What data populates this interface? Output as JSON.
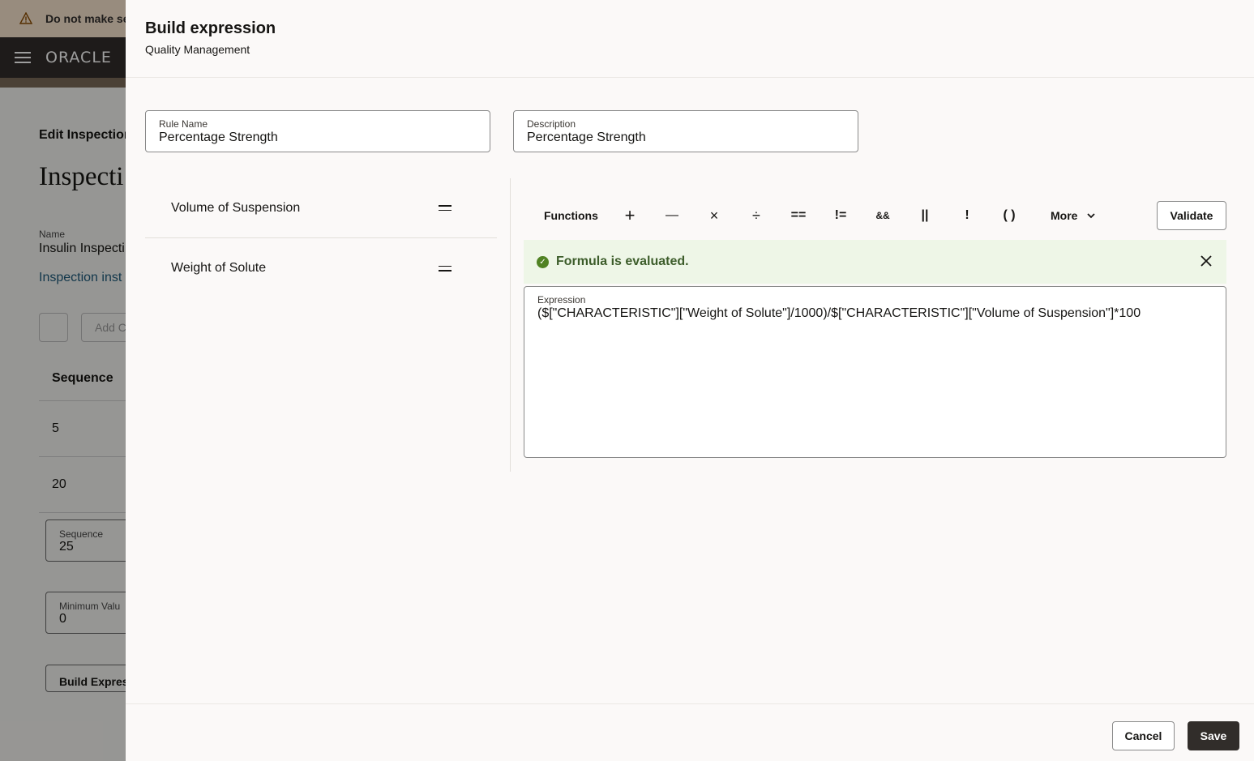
{
  "background": {
    "banner_text": "Do not make se",
    "logo_text": "ORACLE",
    "breadcrumb": "Edit Inspection",
    "page_title": "Inspecti",
    "name_label": "Name",
    "name_value": "Insulin Inspecti",
    "link_text": "Inspection inst",
    "add_button": "Add C",
    "sequence_header": "Sequence",
    "rows": [
      "5",
      "20"
    ],
    "sequence_field": {
      "label": "Sequence",
      "value": "25"
    },
    "min_value_field": {
      "label": "Minimum Valu",
      "value": "0"
    },
    "build_button": "Build Express"
  },
  "drawer": {
    "title": "Build expression",
    "subtitle": "Quality Management",
    "rule_name": {
      "label": "Rule Name",
      "value": "Percentage Strength"
    },
    "description": {
      "label": "Description",
      "value": "Percentage Strength"
    },
    "characteristics": [
      {
        "name": "Volume of Suspension",
        "icon": "drag-handle-icon"
      },
      {
        "name": "Weight of Solute",
        "icon": "drag-handle-icon"
      }
    ],
    "toolbar": {
      "functions_label": "Functions",
      "operators": [
        "+",
        "—",
        "×",
        "÷",
        "==",
        "!=",
        "&&",
        "||",
        "!",
        "( )"
      ],
      "more_label": "More",
      "validate_label": "Validate"
    },
    "message": {
      "text": "Formula is evaluated.",
      "type": "success",
      "color": "#508223"
    },
    "expression": {
      "label": "Expression",
      "value": "($[\"CHARACTERISTIC\"][\"Weight of Solute\"]/1000)/$[\"CHARACTERISTIC\"][\"Volume of Suspension\"]*100"
    },
    "footer": {
      "cancel_label": "Cancel",
      "save_label": "Save"
    }
  }
}
